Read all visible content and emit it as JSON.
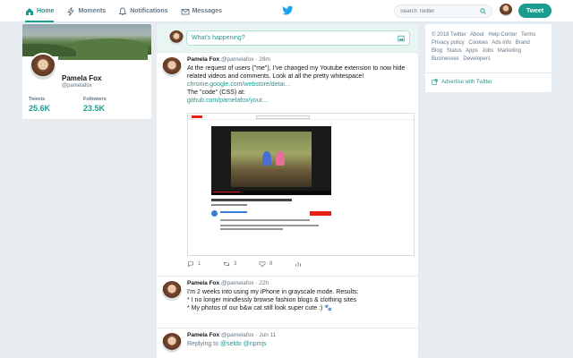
{
  "nav": {
    "home": "Home",
    "moments": "Moments",
    "notifications": "Notifications",
    "messages": "Messages"
  },
  "search": {
    "placeholder": "Search Twitter"
  },
  "tweet_button": "Tweet",
  "profile": {
    "name": "Pamela Fox",
    "handle": "@pamelafox",
    "tweets_label": "Tweets",
    "tweets_value": "25.6K",
    "followers_label": "Followers",
    "followers_value": "23.5K"
  },
  "compose": {
    "placeholder": "What's happening?"
  },
  "tweets": [
    {
      "name": "Pamela Fox",
      "handle": "@pamelafox",
      "time": "· 28m",
      "lines": [
        "At the request of users (\"me\"), I've changed my Youtube extension to now hide",
        "related videos and comments. Look at all the pretty whitespace!"
      ],
      "link1": "chrome.google.com/webstore/detai…",
      "line3": "The \"code\" (CSS) at:",
      "link2": "github.com/pamelafox/yout…",
      "reply_count": "1",
      "retweet_count": "3",
      "like_count": "8"
    },
    {
      "name": "Pamela Fox",
      "handle": "@pamelafox",
      "time": "· 22h",
      "lines": [
        "I'm 2 weeks into using my iPhone in grayscale mode. Results:",
        "* I no longer mindlessly browse fashion blogs & clothing sites",
        "* My photos of our b&w cat still look super cute :) 🐾"
      ]
    },
    {
      "name": "Pamela Fox",
      "handle": "@pamelafox",
      "time": "· Jun 11",
      "reply_prefix": "Replying to",
      "reply_to": "@seldo @npmjs"
    }
  ],
  "footer": {
    "links": [
      "© 2018 Twitter",
      "About",
      "Help Center",
      "Terms",
      "Privacy policy",
      "Cookies",
      "Ads info",
      "Brand",
      "Blog",
      "Status",
      "Apps",
      "Jobs",
      "Marketing",
      "Businesses",
      "Developers"
    ],
    "advertise": "Advertise with Twitter"
  },
  "colors": {
    "accent": "#1a9c8f",
    "background": "#e6ecf0",
    "muted": "#657786"
  }
}
